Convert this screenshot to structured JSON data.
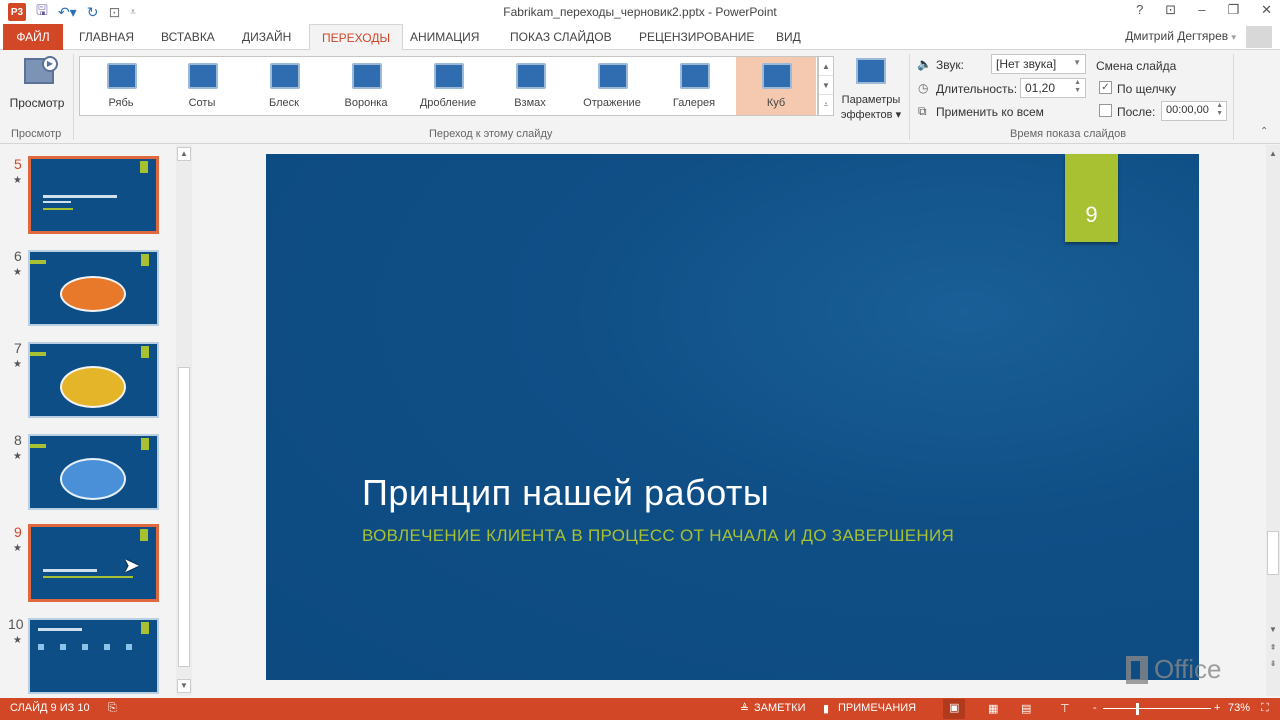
{
  "titlebar": {
    "title": "Fabrikam_переходы_черновик2.pptx - PowerPoint",
    "qat_icons": [
      "powerpoint-logo",
      "save-icon",
      "undo-icon",
      "redo-icon",
      "start-slideshow-icon",
      "customize-qat-icon"
    ],
    "app_badge": "P3",
    "controls": {
      "help": "?",
      "ribbon_display": "⊡",
      "minimize": "–",
      "restore": "❐",
      "close": "✕"
    }
  },
  "tabs": [
    {
      "label": "ФАЙЛ",
      "active": false
    },
    {
      "label": "ГЛАВНАЯ",
      "active": false
    },
    {
      "label": "ВСТАВКА",
      "active": false
    },
    {
      "label": "ДИЗАЙН",
      "active": false
    },
    {
      "label": "ПЕРЕХОДЫ",
      "active": true
    },
    {
      "label": "АНИМАЦИЯ",
      "active": false
    },
    {
      "label": "ПОКАЗ СЛАЙДОВ",
      "active": false
    },
    {
      "label": "РЕЦЕНЗИРОВАНИЕ",
      "active": false
    },
    {
      "label": "ВИД",
      "active": false
    }
  ],
  "user": {
    "name": "Дмитрий Дегтярев",
    "dropdown": "▾"
  },
  "ribbon": {
    "preview": {
      "button_label": "Просмотр",
      "group_label": "Просмотр"
    },
    "transitions": {
      "group_label": "Переход к этому слайду",
      "items": [
        {
          "label": "Рябь",
          "selected": false
        },
        {
          "label": "Соты",
          "selected": false
        },
        {
          "label": "Блеск",
          "selected": false
        },
        {
          "label": "Воронка",
          "selected": false
        },
        {
          "label": "Дробление",
          "selected": false
        },
        {
          "label": "Взмах",
          "selected": false
        },
        {
          "label": "Отражение",
          "selected": false
        },
        {
          "label": "Галерея",
          "selected": false
        },
        {
          "label": "Куб",
          "selected": true
        }
      ],
      "scroll": {
        "up": "▲",
        "down": "▼",
        "more": "⩡"
      },
      "effect_options": {
        "line1": "Параметры",
        "line2": "эффектов ▾"
      }
    },
    "timing": {
      "group_label": "Время показа слайдов",
      "sound_label": "Звук:",
      "sound_value": "[Нет звука]",
      "duration_label": "Длительность:",
      "duration_value": "01,20",
      "apply_all_label": "Применить ко всем",
      "advance_title": "Смена слайда",
      "on_click_label": "По щелчку",
      "on_click_checked": true,
      "after_label": "После:",
      "after_checked": false,
      "after_value": "00:00,00",
      "collapse": "⌃"
    }
  },
  "thumbnails": [
    {
      "num": "5",
      "selected": true,
      "kind": "title"
    },
    {
      "num": "6",
      "selected": false,
      "kind": "orange-bubble"
    },
    {
      "num": "7",
      "selected": false,
      "kind": "yellow-bubble"
    },
    {
      "num": "8",
      "selected": false,
      "kind": "blue-bubble"
    },
    {
      "num": "9",
      "selected": true,
      "kind": "title"
    },
    {
      "num": "10",
      "selected": false,
      "kind": "process"
    }
  ],
  "slide": {
    "number": "9",
    "title": "Принцип нашей работы",
    "subtitle": "ВОВЛЕЧЕНИЕ КЛИЕНТА В ПРОЦЕСС ОТ НАЧАЛА И ДО ЗАВЕРШЕНИЯ",
    "background": "#0f4f86",
    "accent": "#a7c132"
  },
  "watermark": "Office",
  "statusbar": {
    "slide_info": "СЛАЙД 9 ИЗ 10",
    "notes": "ЗАМЕТКИ",
    "comments": "ПРИМЕЧАНИЯ",
    "zoom_minus": "-",
    "zoom_plus": "+",
    "zoom": "73%",
    "accent": "#d24726"
  }
}
